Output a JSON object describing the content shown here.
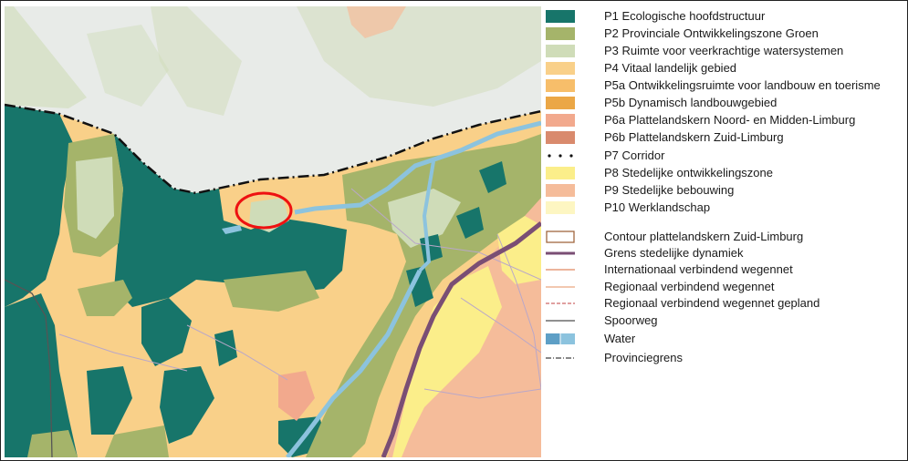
{
  "colors": {
    "p1": "#17756a",
    "p2": "#a5b46a",
    "p3": "#cfdcb8",
    "p4": "#f9d089",
    "p5a": "#f7be6a",
    "p5b": "#eba746",
    "p6a": "#f2a98d",
    "p6b": "#d98a6d",
    "p8": "#fbee8a",
    "p9": "#f5bc9a",
    "p10": "#fdf6c2",
    "river": "#8cc3de",
    "grens_stedelijk": "#7a4e74",
    "provincie_outside": "#e8ebe8",
    "roads": "#b9a7c9"
  },
  "legend": {
    "p1": "P1 Ecologische hoofdstructuur",
    "p2": "P2 Provinciale Ontwikkelingszone Groen",
    "p3": "P3 Ruimte voor veerkrachtige watersystemen",
    "p4": "P4 Vitaal landelijk gebied",
    "p5a": "P5a Ontwikkelingsruimte voor landbouw en toerisme",
    "p5b": "P5b Dynamisch landbouwgebied",
    "p6a": "P6a Plattelandskern Noord- en Midden-Limburg",
    "p6b": "P6b Plattelandskern Zuid-Limburg",
    "p7": "P7 Corridor",
    "p8": "P8 Stedelijke ontwikkelingszone",
    "p9": "P9 Stedelijke bebouwing",
    "p10": "P10 Werklandschap",
    "contour": "Contour plattelandskern Zuid-Limburg",
    "grens": "Grens stedelijke dynamiek",
    "internationaal": "Internationaal verbindend wegennet",
    "regionaal": "Regionaal verbindend wegennet",
    "regionaal_gepland": "Regionaal verbindend wegennet gepland",
    "spoorweg": "Spoorweg",
    "water": "Water",
    "provinciegrens": "Provinciegrens"
  }
}
